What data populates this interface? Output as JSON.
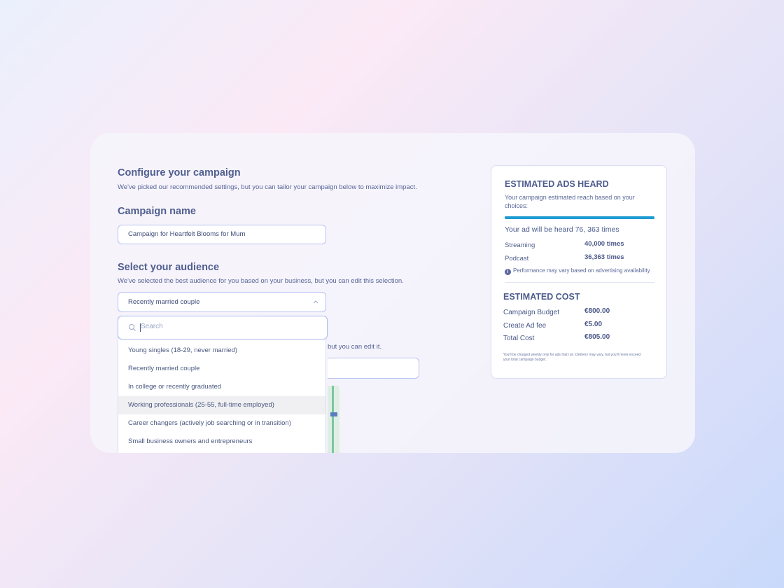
{
  "configure": {
    "title": "Configure your campaign",
    "subtitle": "We've picked our recommended settings, but you can tailor your campaign below to maximize impact."
  },
  "campaign_name": {
    "label": "Campaign name",
    "value": "Campaign for Heartfelt Blooms for Mum"
  },
  "audience": {
    "label": "Select your audience",
    "subtitle": "We've selected the best audience for you based on your business, but you can edit this selection.",
    "selected": "Recently married couple",
    "search_placeholder": "Search",
    "options": [
      "Young singles (18-29, never married)",
      "Recently married couple",
      "In college or recently graduated",
      "Working professionals (25-55, full-time employed)",
      "Career changers (actively job searching or in transition)",
      "Small business owners and entrepreneurs"
    ],
    "highlighted_index": 3
  },
  "location": {
    "help_text_partial": "but you can edit it."
  },
  "estimate": {
    "title": "ESTIMATED ADS HEARD",
    "subtitle": "Your campaign estimated reach based on your choices:",
    "progress": 1.0,
    "reach_text": "Your ad will be heard 76, 363 times",
    "rows": [
      {
        "label": "Streaming",
        "value": "40,000 times"
      },
      {
        "label": "Podcast",
        "value": "36,363 times"
      }
    ],
    "note": "Performance may vary based on advertising availability"
  },
  "cost": {
    "title": "ESTIMATED COST",
    "rows": [
      {
        "label": "Campaign Budget",
        "value": "€800.00"
      },
      {
        "label": "Create Ad fee",
        "value": "€5.00"
      },
      {
        "label": "Total Cost",
        "value": "€805.00"
      }
    ],
    "fine_print": "You'll be charged weekly only for ads that run. Delivery may vary, but you'll never exceed your total campaign budget."
  },
  "colors": {
    "accent_bar": "#1e9bd2",
    "field_border": "#b8c3f2"
  }
}
